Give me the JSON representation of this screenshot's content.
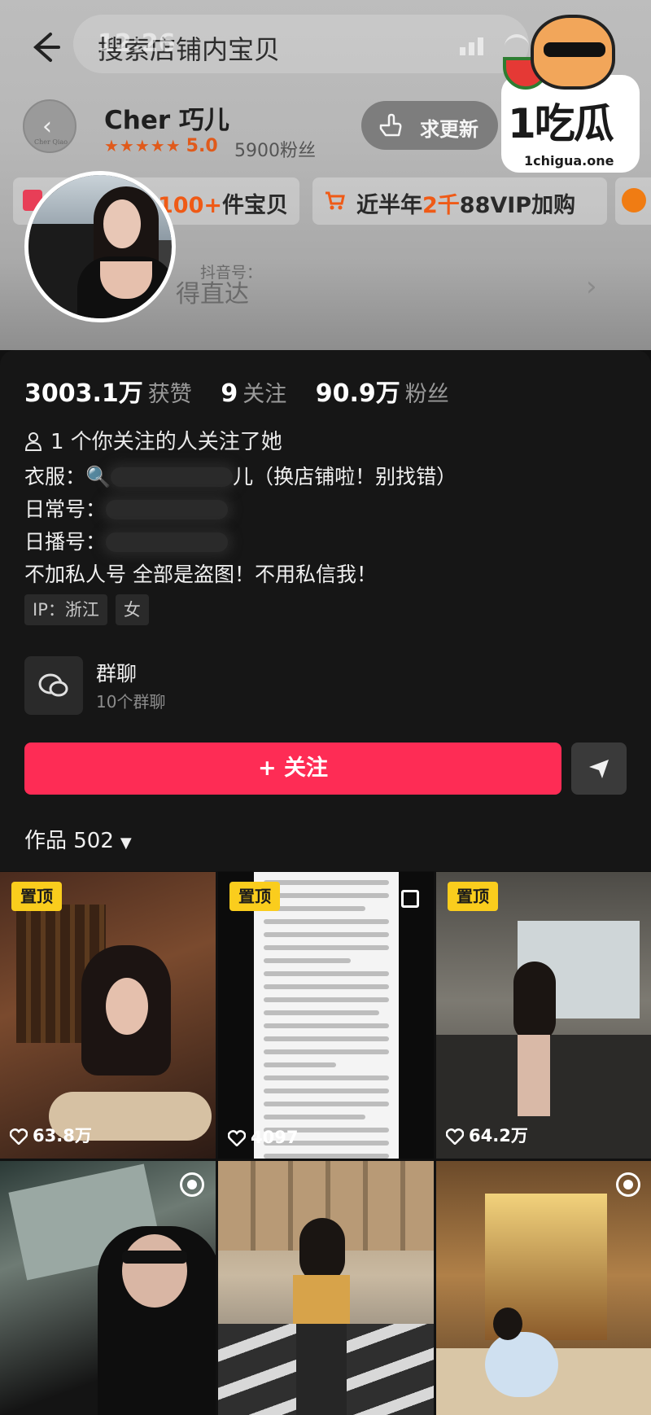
{
  "header": {
    "search_placeholder": "搜索店铺内宝贝",
    "faint_status": "12:26"
  },
  "shop": {
    "name": "Cher 巧儿",
    "logo_text": "Cher Qiao",
    "stars": "★★★★★",
    "score": "5.0",
    "fans": "5900粉丝",
    "update_label": "求更新"
  },
  "chips": {
    "items_prefix": "",
    "items_value": "100+",
    "items_suffix": "件宝贝",
    "vip_prefix": "近半年",
    "vip_value": "2千",
    "vip_suffix": "88VIP加购"
  },
  "direct": {
    "douyin_tag": "抖音号：",
    "text": "得直达"
  },
  "watermark": {
    "big": "1吃瓜",
    "url": "1chigua.one"
  },
  "profile": {
    "likes_num": "3003.1万",
    "likes_label": "获赞",
    "following_num": "9",
    "following_label": "关注",
    "followers_num": "90.9万",
    "followers_label": "粉丝",
    "mutual": "1 个你关注的人关注了她",
    "bio_line1_prefix": "衣服：",
    "bio_line1_suffix": "儿（换店铺啦！别找错）",
    "bio_line2": "日常号：",
    "bio_line3": "日播号：",
    "bio_line4": "不加私人号 全部是盗图！不用私信我！",
    "tag_ip": "IP：浙江",
    "tag_gender": "女",
    "group_title": "群聊",
    "group_sub": "10个群聊",
    "follow_label": "+ 关注",
    "works_label": "作品 502"
  },
  "grid": [
    {
      "pinned": "置顶",
      "likes": "63.8万"
    },
    {
      "pinned": "置顶",
      "likes": "4097"
    },
    {
      "pinned": "置顶",
      "likes": "64.2万"
    },
    {
      "pinned": "",
      "likes": ""
    },
    {
      "pinned": "",
      "likes": ""
    },
    {
      "pinned": "",
      "likes": ""
    }
  ],
  "colors": {
    "follow": "#fe2c55",
    "pin": "#facd1d",
    "rating": "#e05a1b",
    "panel": "#161616"
  },
  "icons": [
    "back-arrow-icon",
    "hand-pointer-icon",
    "cart-icon",
    "person-icon",
    "chat-icon",
    "share-arrow-icon",
    "heart-icon",
    "live-icon",
    "chevron-right-icon"
  ]
}
